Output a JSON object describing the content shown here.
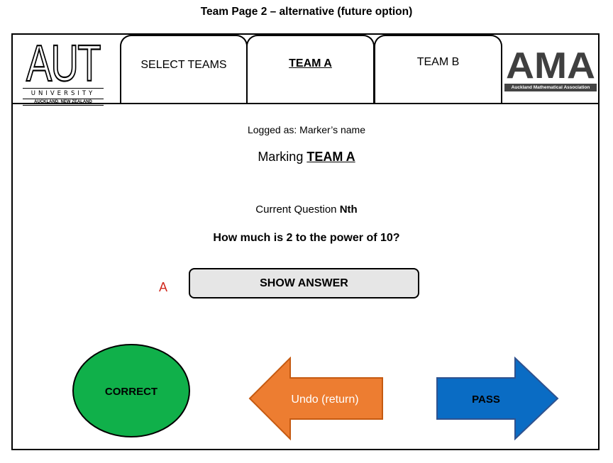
{
  "page_title": "Team Page 2 – alternative (future option)",
  "header": {
    "aut_logo": {
      "text": "AUT",
      "university": "UNIVERSITY",
      "location": "AUCKLAND, NEW ZEALAND"
    },
    "tabs": [
      {
        "label": "SELECT TEAMS",
        "active": false
      },
      {
        "label": "TEAM A",
        "active": true
      },
      {
        "label": "TEAM B",
        "active": false
      }
    ],
    "ama_logo": {
      "text": "AMA",
      "association": "Auckland Mathematical Association"
    }
  },
  "main": {
    "logged_prefix": "Logged as: ",
    "logged_name": "Marker’s name",
    "marking_prefix": "Marking ",
    "marking_team": "TEAM A",
    "current_question_prefix": "Current Question ",
    "current_question_value": "Nth",
    "question": "How much is 2 to the power of 10?",
    "answer_marker": "A",
    "show_answer_label": "SHOW ANSWER"
  },
  "actions": {
    "correct_label": "CORRECT",
    "undo_label": "Undo (return)",
    "pass_label": "PASS"
  },
  "colors": {
    "correct": "#10b04a",
    "undo": "#ed7d31",
    "pass": "#0a6cc4",
    "answer_marker": "#d0281d",
    "show_answer_bg": "#e6e6e6"
  }
}
